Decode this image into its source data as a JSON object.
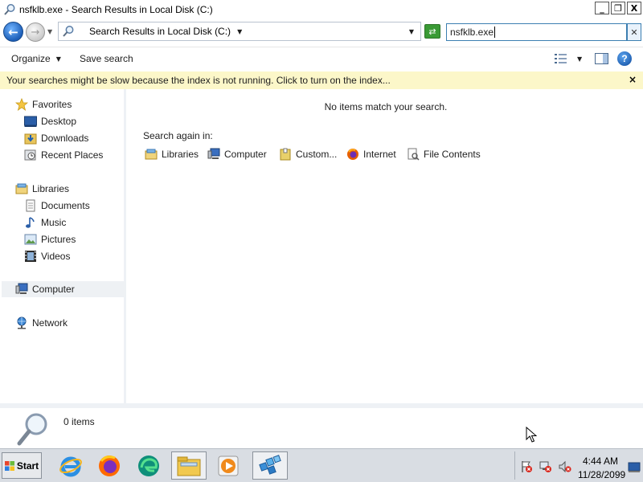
{
  "window": {
    "title": "nsfklb.exe - Search Results in Local Disk (C:)",
    "controls": {
      "minimize": "_",
      "maximize": "❐",
      "close": "X"
    }
  },
  "address": {
    "crumb": "Search Results in Local Disk (C:)",
    "search_value": "nsfklb.exe"
  },
  "toolbar": {
    "organize": "Organize",
    "save_search": "Save search",
    "help": "?"
  },
  "infobar": {
    "message": "Your searches might be slow because the index is not running.  Click to turn on the index...",
    "close": "×"
  },
  "nav": {
    "favorites": "Favorites",
    "desktop": "Desktop",
    "downloads": "Downloads",
    "recent_places": "Recent Places",
    "libraries": "Libraries",
    "documents": "Documents",
    "music": "Music",
    "pictures": "Pictures",
    "videos": "Videos",
    "computer": "Computer",
    "network": "Network"
  },
  "content": {
    "empty_message": "No items match your search.",
    "search_again_label": "Search again in:",
    "search_again": {
      "libraries": "Libraries",
      "computer": "Computer",
      "custom": "Custom...",
      "internet": "Internet",
      "file_contents": "File Contents"
    }
  },
  "details": {
    "count": "0 items"
  },
  "taskbar": {
    "start": "Start",
    "time": "4:44 AM",
    "date": "11/28/2099",
    "apps": [
      "internet-explorer-icon",
      "firefox-icon",
      "edge-icon",
      "file-explorer-icon",
      "media-player-icon",
      "registry-editor-icon"
    ]
  },
  "colors": {
    "infobar_bg": "#fcf7c9",
    "accent_blue": "#1d5fb8",
    "taskbar_bg": "#d9dde3"
  }
}
